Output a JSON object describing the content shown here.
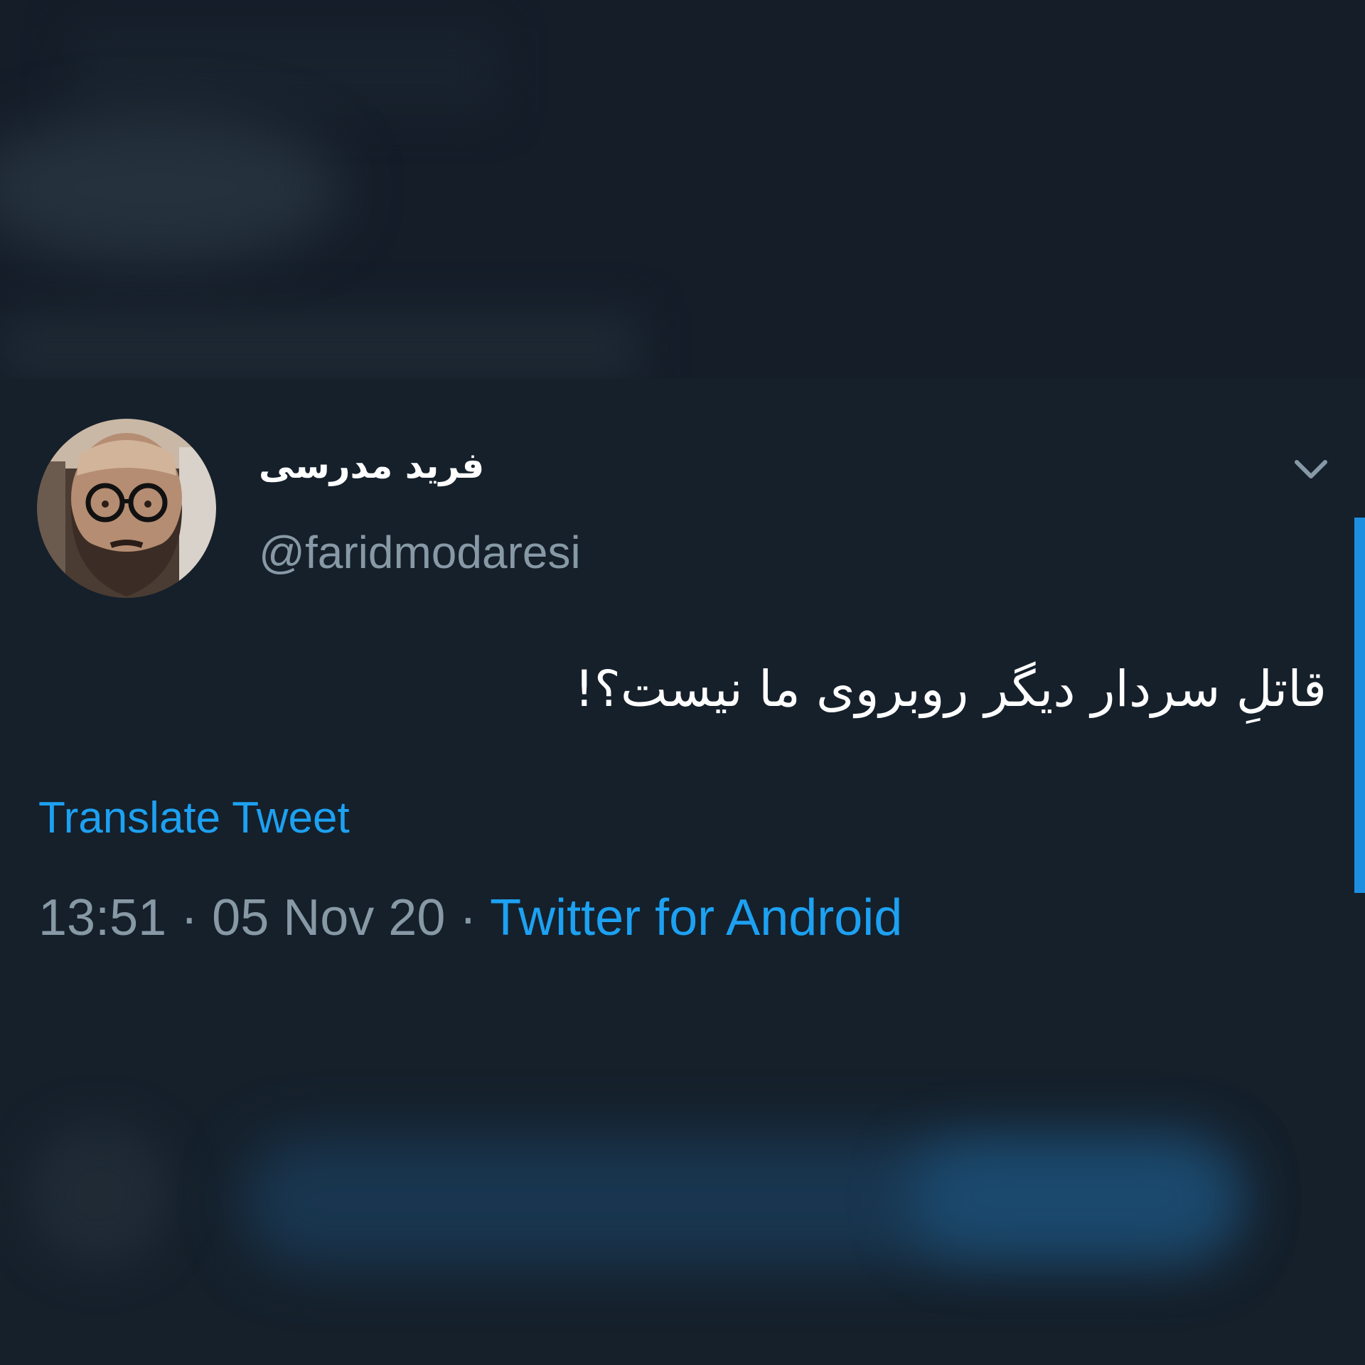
{
  "tweet": {
    "display_name": "فرید مدرسی",
    "handle": "@faridmodaresi",
    "text": "قاتلِ سردار دیگر روبروی ما نیست؟!",
    "translate_label": "Translate Tweet",
    "time": "13:51",
    "separator": " · ",
    "date": "05 Nov 20",
    "source": "Twitter for Android",
    "menu_icon": "chevron-down-icon",
    "avatar_icon": "profile-avatar"
  },
  "colors": {
    "background": "#15202b",
    "accent": "#1da1f2",
    "secondary_text": "#8899a6",
    "primary_text": "#ffffff"
  }
}
